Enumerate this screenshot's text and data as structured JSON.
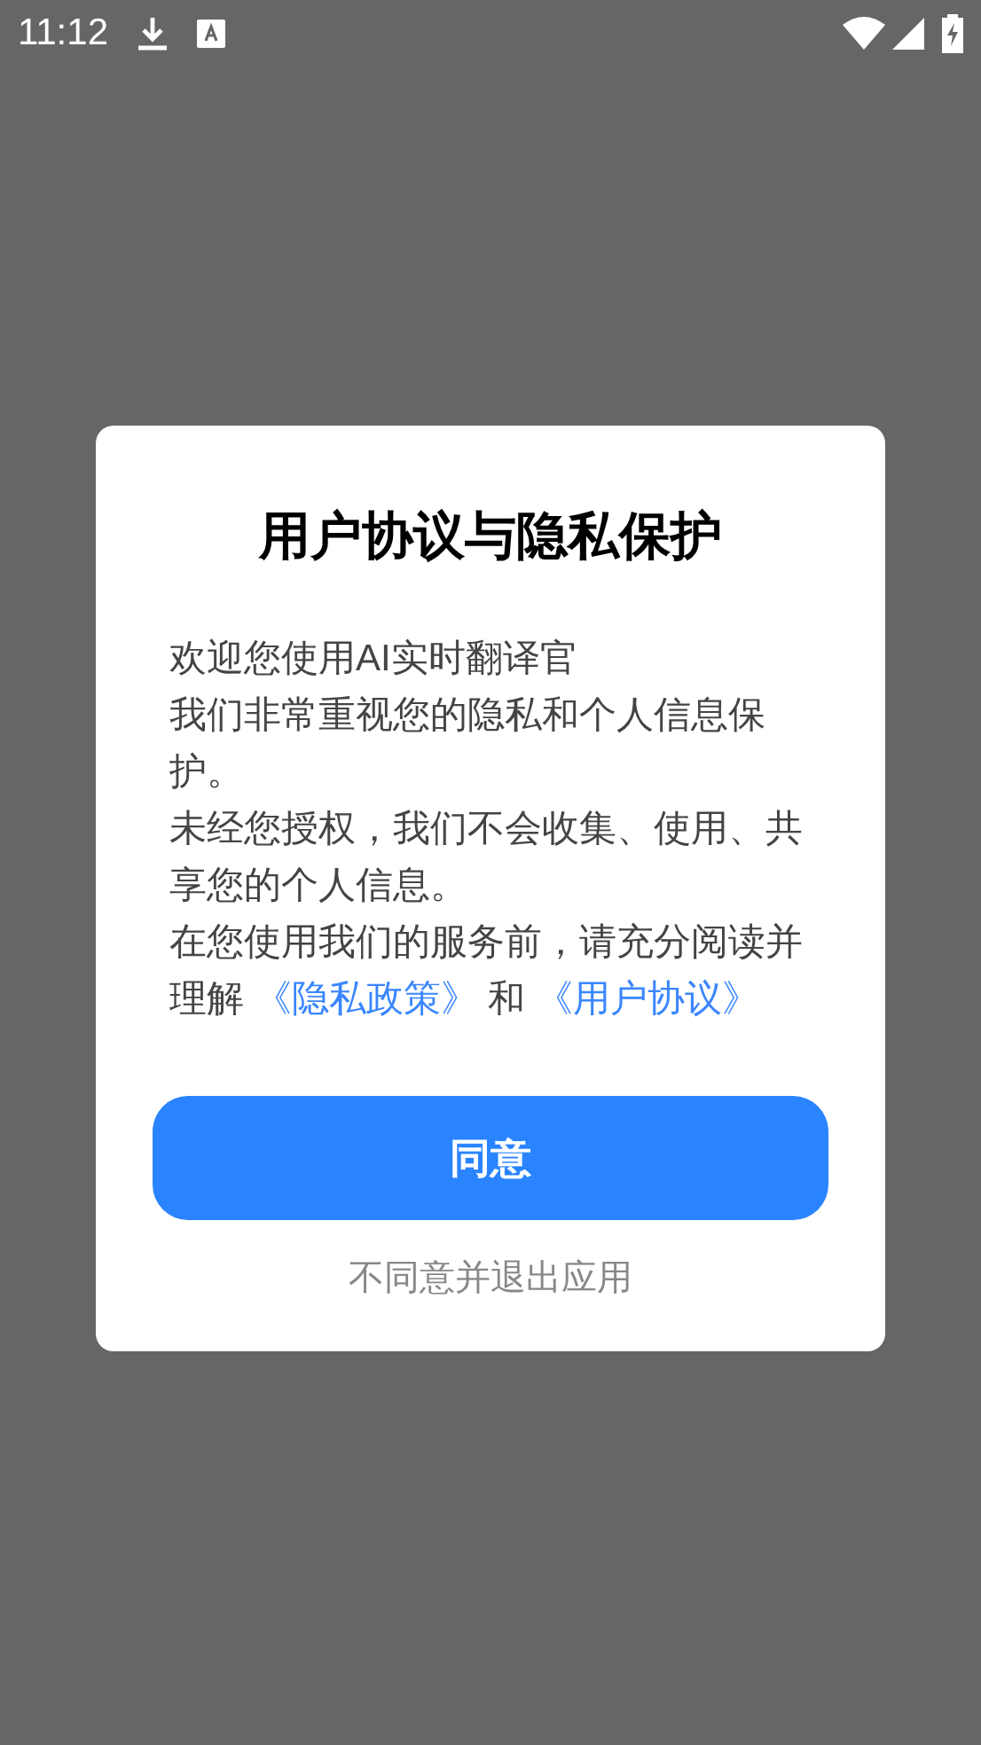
{
  "status_bar": {
    "time": "11:12"
  },
  "dialog": {
    "title": "用户协议与隐私保护",
    "paragraphs": [
      "欢迎您使用AI实时翻译官",
      "我们非常重视您的隐私和个人信息保护。",
      "未经您授权，我们不会收集、使用、共享您的个人信息。"
    ],
    "last_paragraph": {
      "before": "在您使用我们的服务前，请充分阅读并理解",
      "link1": "《隐私政策》",
      "middle": "和",
      "link2": "《用户协议》"
    },
    "agree_button": "同意",
    "decline_link": "不同意并退出应用"
  }
}
